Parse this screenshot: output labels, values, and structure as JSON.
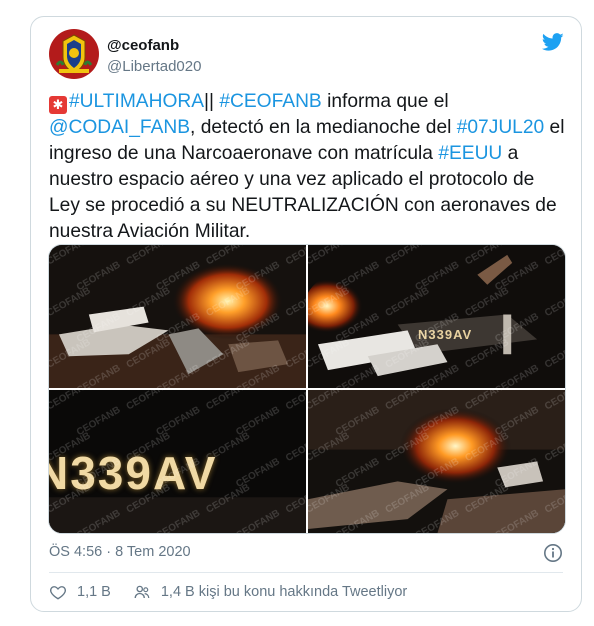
{
  "author": {
    "display_name": "@ceofanb",
    "handle": "@Libertad020",
    "avatar_icon": "military-crest-icon"
  },
  "platform_icon": "twitter-bird-icon",
  "tweet": {
    "segments": [
      {
        "text": "#ULTIMAHORA",
        "link": true
      },
      {
        "text": "|| ",
        "link": false
      },
      {
        "text": "#CEOFANB",
        "link": true
      },
      {
        "text": " informa que el ",
        "link": false
      },
      {
        "text": "@CODAI_FANB",
        "link": true
      },
      {
        "text": ", detectó en la medianoche del ",
        "link": false
      },
      {
        "text": "#07JUL20",
        "link": true
      },
      {
        "text": " el ingreso de una Narcoaeronave con matrícula ",
        "link": false
      },
      {
        "text": "#EEUU",
        "link": true
      },
      {
        "text": " a nuestro espacio aéreo y una vez aplicado el protocolo de Ley se procedió a su NEUTRALIZACIÓN con aeronaves de nuestra Aviación Militar.",
        "link": false
      }
    ]
  },
  "media": {
    "watermark": "CEOFANB",
    "photos": [
      {
        "name": "photo-wreckage-fire-1"
      },
      {
        "name": "photo-wreckage-fire-2",
        "tail_text": "N339AV"
      },
      {
        "name": "photo-tail-number",
        "tail_text": "N339AV"
      },
      {
        "name": "photo-wreckage-fire-3"
      }
    ]
  },
  "timestamp": "ÖS 4:56 · 8 Tem 2020",
  "actions": {
    "likes": "1,1 B",
    "talking": "1,4 B kişi bu konu hakkında Tweetliyor"
  },
  "colors": {
    "link": "#1b95e0",
    "secondary_text": "#657786",
    "twitter_blue": "#1da1f2",
    "border": "#cfd9de"
  }
}
